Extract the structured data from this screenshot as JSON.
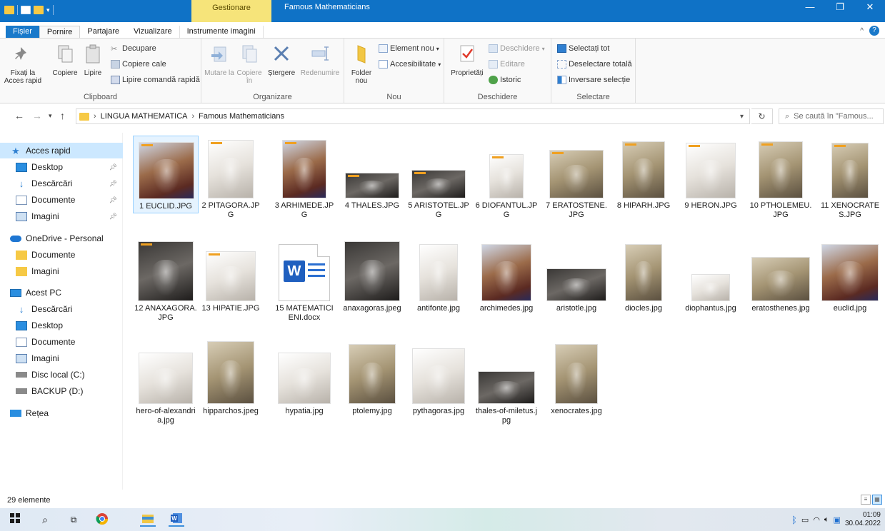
{
  "titlebar": {
    "context_tab": "Gestionare",
    "title": "Famous Mathematicians",
    "minimize": "—",
    "restore": "❐",
    "close": "✕"
  },
  "tabs": {
    "file": "Fișier",
    "home": "Pornire",
    "share": "Partajare",
    "view": "Vizualizare",
    "image_tools": "Instrumente imagini",
    "help": "?"
  },
  "ribbon": {
    "clipboard": {
      "label": "Clipboard",
      "pin": "Fixați la Acces rapid",
      "copy": "Copiere",
      "paste": "Lipire",
      "cut": "Decupare",
      "copy_path": "Copiere cale",
      "paste_shortcut": "Lipire comandă rapidă"
    },
    "organize": {
      "label": "Organizare",
      "move_to": "Mutare la",
      "copy_to": "Copiere în",
      "delete": "Ștergere",
      "rename": "Redenumire"
    },
    "new": {
      "label": "Nou",
      "new_folder": "Folder nou",
      "new_item": "Element nou",
      "easy_access": "Accesibilitate"
    },
    "open": {
      "label": "Deschidere",
      "properties": "Proprietăți",
      "open": "Deschidere",
      "edit": "Editare",
      "history": "Istoric"
    },
    "select": {
      "label": "Selectare",
      "select_all": "Selectați tot",
      "select_none": "Deselectare totală",
      "invert": "Inversare selecție"
    }
  },
  "address": {
    "crumbs": [
      "LINGUA MATHEMATICA",
      "Famous Mathematicians"
    ],
    "search_placeholder": "Se caută în \"Famous..."
  },
  "navpane": {
    "items": [
      {
        "label": "Acces rapid",
        "icon": "star-icon",
        "pinned": false,
        "selected": true
      },
      {
        "label": "Desktop",
        "icon": "desktop-icon",
        "pinned": true
      },
      {
        "label": "Descărcări",
        "icon": "download-icon",
        "pinned": true
      },
      {
        "label": "Documente",
        "icon": "document-icon",
        "pinned": true
      },
      {
        "label": "Imagini",
        "icon": "pictures-icon",
        "pinned": true
      },
      {
        "label": "OneDrive - Personal",
        "icon": "cloud-icon"
      },
      {
        "label": "Documente",
        "icon": "folder-icon"
      },
      {
        "label": "Imagini",
        "icon": "folder-icon"
      },
      {
        "label": "Acest PC",
        "icon": "pc-icon"
      },
      {
        "label": "Descărcări",
        "icon": "download-icon"
      },
      {
        "label": "Desktop",
        "icon": "desktop-icon"
      },
      {
        "label": "Documente",
        "icon": "document-icon"
      },
      {
        "label": "Imagini",
        "icon": "pictures-icon"
      },
      {
        "label": "Disc local (C:)",
        "icon": "drive-icon"
      },
      {
        "label": "BACKUP (D:)",
        "icon": "drive-icon"
      },
      {
        "label": "Rețea",
        "icon": "network-icon"
      }
    ]
  },
  "files": [
    {
      "name": "1 EUCLID.JPG",
      "thumb": "color",
      "selected": true
    },
    {
      "name": "2 PITAGORA.JPG",
      "thumb": "light"
    },
    {
      "name": "3 ARHIMEDE.JPG",
      "thumb": "color"
    },
    {
      "name": "4 THALES.JPG",
      "thumb": "dark"
    },
    {
      "name": "5 ARISTOTEL.JPG",
      "thumb": "dark"
    },
    {
      "name": "6 DIOFANTUL.JPG",
      "thumb": "light"
    },
    {
      "name": "7 ERATOSTENE.JPG",
      "thumb": "sepia"
    },
    {
      "name": "8 HIPARH.JPG",
      "thumb": "sepia"
    },
    {
      "name": "9 HERON.JPG",
      "thumb": "light"
    },
    {
      "name": "10 PTHOLEMEU.JPG",
      "thumb": "sepia"
    },
    {
      "name": "11 XENOCRATES.JPG",
      "thumb": "sepia"
    },
    {
      "name": "12 ANAXAGORA.JPG",
      "thumb": "dark"
    },
    {
      "name": "13 HIPATIE.JPG",
      "thumb": "light"
    },
    {
      "name": "15 MATEMATICIENI.docx",
      "thumb": "word"
    },
    {
      "name": "anaxagoras.jpeg",
      "thumb": "dark"
    },
    {
      "name": "antifonte.jpg",
      "thumb": "light"
    },
    {
      "name": "archimedes.jpg",
      "thumb": "color"
    },
    {
      "name": "aristotle.jpg",
      "thumb": "dark"
    },
    {
      "name": "diocles.jpg",
      "thumb": "sepia"
    },
    {
      "name": "diophantus.jpg",
      "thumb": "light"
    },
    {
      "name": "eratosthenes.jpg",
      "thumb": "sepia"
    },
    {
      "name": "euclid.jpg",
      "thumb": "color"
    },
    {
      "name": "hero-of-alexandria.jpg",
      "thumb": "light"
    },
    {
      "name": "hipparchos.jpeg",
      "thumb": "sepia"
    },
    {
      "name": "hypatia.jpg",
      "thumb": "light"
    },
    {
      "name": "ptolemy.jpg",
      "thumb": "sepia"
    },
    {
      "name": "pythagoras.jpg",
      "thumb": "light"
    },
    {
      "name": "thales-of-miletus.jpg",
      "thumb": "dark"
    },
    {
      "name": "xenocrates.jpg",
      "thumb": "sepia"
    }
  ],
  "status": {
    "count": "29 elemente"
  },
  "taskbar": {
    "time": "01:09",
    "date": "30.04.2022"
  },
  "colors": {
    "titlebar": "#0f72c6",
    "context_tab": "#f6e47a",
    "selection": "#cce8ff"
  }
}
